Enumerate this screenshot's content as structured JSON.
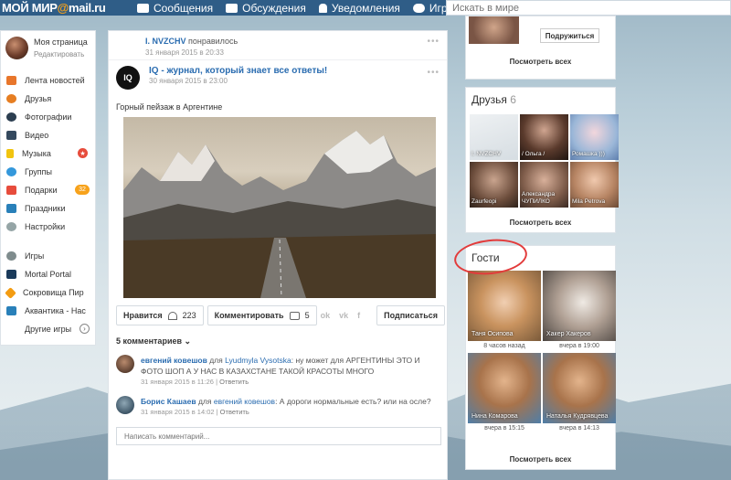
{
  "header": {
    "logo_prefix": "МОЙ МИР",
    "logo_at": "@",
    "logo_suffix": "mail.ru",
    "nav": [
      "Сообщения",
      "Обсуждения",
      "Уведомления",
      "Игры"
    ],
    "search_placeholder": "Искать в мире",
    "accent_color": "#2f5d87"
  },
  "sidebar": {
    "profile_name": "Моя страница",
    "profile_edit": "Редактировать",
    "items": [
      {
        "label": "Лента новостей",
        "icon": "house-icon",
        "color": "#e8762b"
      },
      {
        "label": "Друзья",
        "icon": "friends-icon",
        "color": "#e67e22"
      },
      {
        "label": "Фотографии",
        "icon": "camera-icon",
        "color": "#2c3e50"
      },
      {
        "label": "Видео",
        "icon": "video-icon",
        "color": "#34495e"
      },
      {
        "label": "Музыка",
        "icon": "music-icon",
        "color": "#f1c40f",
        "badge": "★"
      },
      {
        "label": "Группы",
        "icon": "groups-icon",
        "color": "#3498db"
      },
      {
        "label": "Подарки",
        "icon": "gift-icon",
        "color": "#e74c3c",
        "badge": "32"
      },
      {
        "label": "Праздники",
        "icon": "calendar-icon",
        "color": "#2980b9"
      },
      {
        "label": "Настройки",
        "icon": "gear-icon",
        "color": "#95a5a6"
      }
    ],
    "games": [
      {
        "label": "Игры",
        "icon": "gamepad-icon",
        "color": "#7f8c8d"
      },
      {
        "label": "Mortal Portal",
        "icon": "mortal-portal-icon",
        "color": "#1a3a5a"
      },
      {
        "label": "Сокровища Пир",
        "icon": "treasure-icon",
        "color": "#f39c12"
      },
      {
        "label": "Аквантика - Нас",
        "icon": "aquantica-icon",
        "color": "#2980b9"
      },
      {
        "label": "Другие игры",
        "icon": "arrow-icon",
        "color": "#ffffff"
      }
    ]
  },
  "feed": {
    "liker_name": "I. NVZCHV",
    "liker_text": " понравилось",
    "like_date": "31 января 2015 в 20:33",
    "post_logo": "IQ",
    "post_title": "IQ - журнал, который знает все ответы!",
    "post_date": "30 января 2015 в 23:00",
    "post_text": "Горный пейзаж в Аргентине",
    "like_label": "Нравится",
    "like_count": "223",
    "comment_label": "Комментировать",
    "comment_count": "5",
    "social": [
      "ok",
      "vk",
      "f"
    ],
    "subscribe_label": "Подписаться",
    "comments_header": "5 комментариев ⌄",
    "comments": [
      {
        "author": "евгений ковешов",
        "to_word": "для",
        "to": "Lyudmyla Vysotska",
        "text": ": ну может для АРГЕНТИНЫ ЭТО И ФОТО ШОП А У НАС В КАЗАХСТАНЕ ТАКОЙ КРАСОТЫ МНОГО",
        "date": "31 января 2015 в 11:26",
        "reply": "Ответить"
      },
      {
        "author": "Борис Кашаев",
        "to_word": "для",
        "to": "евгений ковешов",
        "text": ": А дороги нормальные есть? или на осле?",
        "date": "31 января 2015 в 14:02",
        "reply": "Ответить"
      }
    ],
    "comment_placeholder": "Написать комментарий..."
  },
  "right": {
    "join_label": "Подружиться",
    "see_all": "Посмотреть всех",
    "friends_title": "Друзья",
    "friends_count": "6",
    "friends": [
      {
        "name": "I. NVZCHV"
      },
      {
        "name": "/ Ольга /"
      },
      {
        "name": "Ромашка )))"
      },
      {
        "name": "Zaurfeopi"
      },
      {
        "name": "Александра ЧУПИЛКО"
      },
      {
        "name": "Mila Petrova"
      }
    ],
    "guests_title": "Гости",
    "guests": [
      {
        "name": "Таня Осипова",
        "time": "8 часов назад"
      },
      {
        "name": "Хакер Хакеров",
        "time": "вчера в 19:00"
      },
      {
        "name": "Нина Комарова",
        "time": "вчера в 15:15"
      },
      {
        "name": "Наталья Кудрявцева",
        "time": "вчера в 14:13"
      }
    ]
  }
}
